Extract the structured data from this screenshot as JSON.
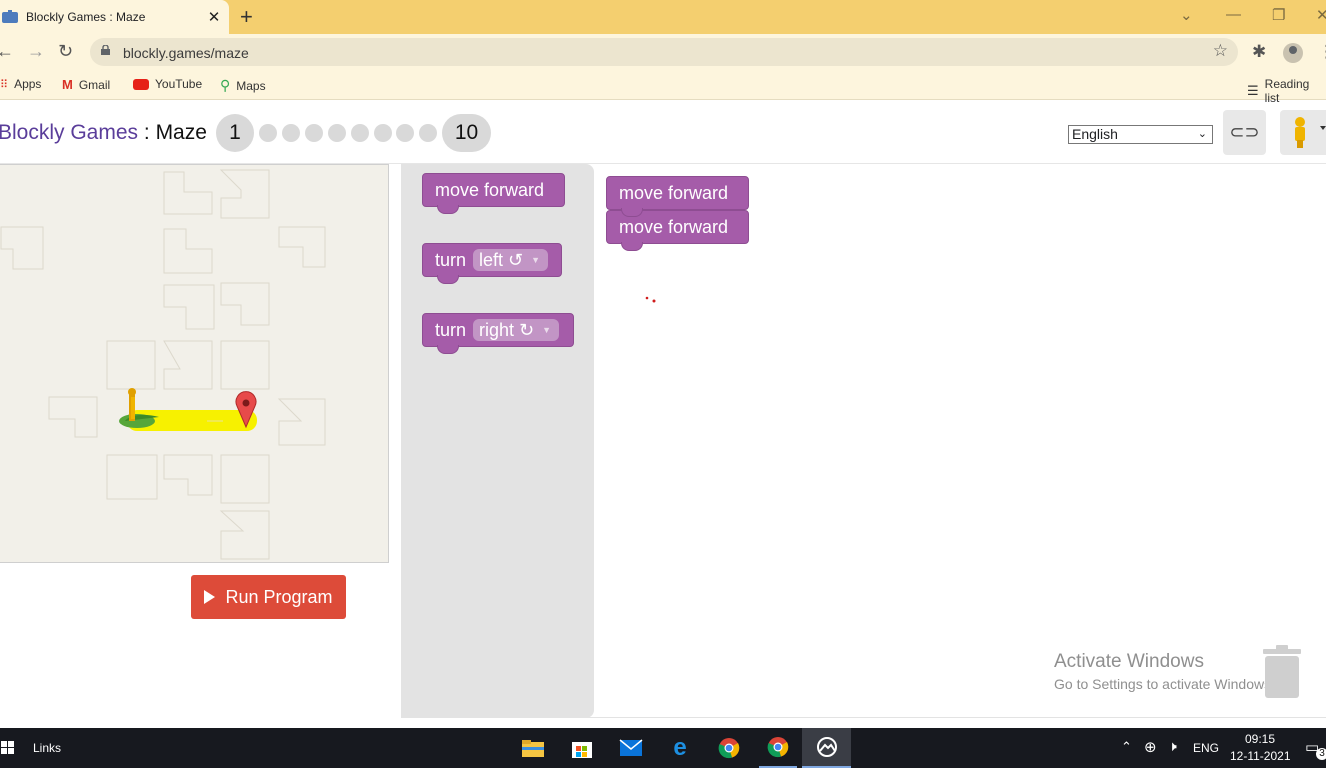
{
  "browser": {
    "tab_title": "Blockly Games : Maze",
    "tab_close": "✕",
    "new_tab": "+",
    "url": "blockly.games/maze",
    "bookmarks": [
      "Apps",
      "Gmail",
      "YouTube",
      "Maps"
    ],
    "reading_list": "Reading list"
  },
  "header": {
    "brand_games": "Blockly Games",
    "brand_sep": " : ",
    "brand_maze": "Maze",
    "level_first": "1",
    "level_last": "10",
    "language": "English"
  },
  "run_button": "Run Program",
  "flyout_blocks": {
    "move_forward": "move forward",
    "turn": "turn",
    "left": "left ↺",
    "right": "right ↻"
  },
  "workspace_blocks": [
    "move forward",
    "move forward"
  ],
  "watermark": {
    "line1": "Activate Windows",
    "line2": "Go to Settings to activate Windows."
  },
  "taskbar": {
    "links": "Links",
    "lang": "ENG",
    "time": "09:15",
    "date": "12-11-2021",
    "notif_count": "3"
  },
  "colors": {
    "block": "#a55ca9",
    "run": "#dd4b39",
    "brand": "#5a3d9a",
    "tabbar": "#f4cf6f"
  }
}
